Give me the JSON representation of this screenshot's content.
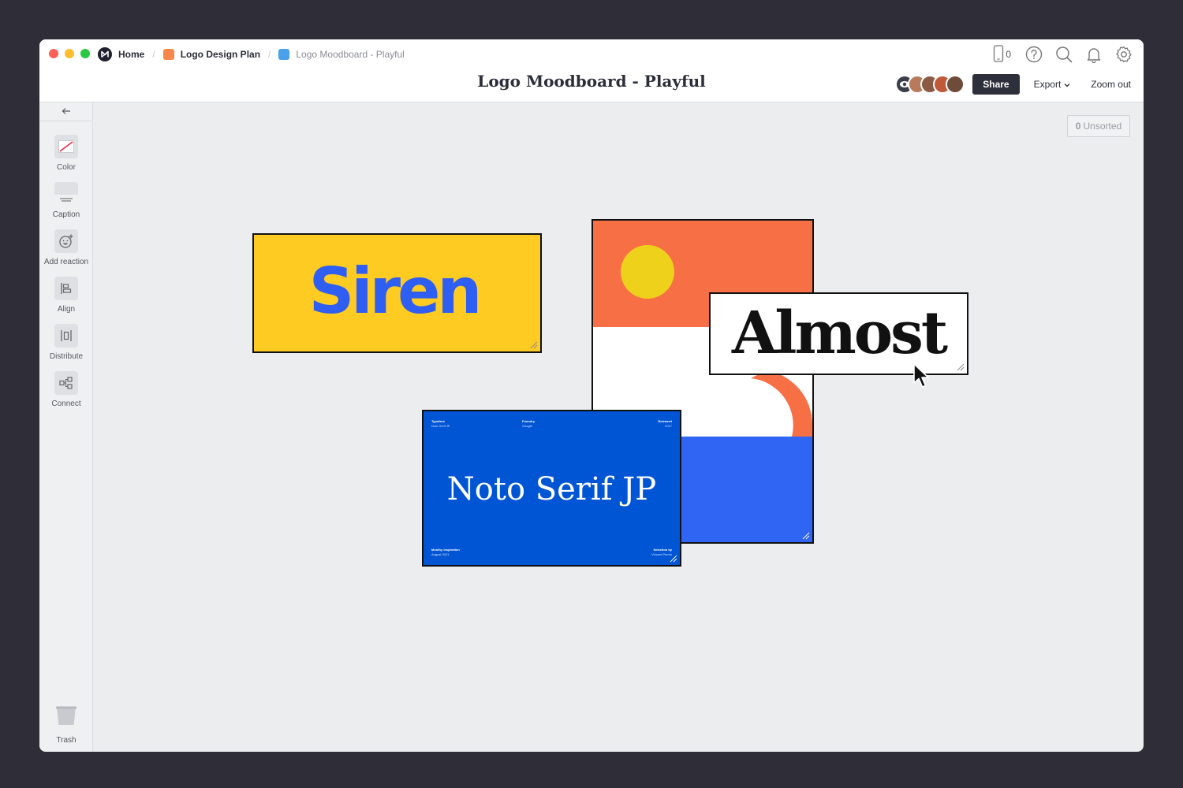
{
  "breadcrumbs": {
    "home": "Home",
    "project": "Logo Design Plan",
    "board": "Logo Moodboard - Playful",
    "project_color": "#f7884a",
    "board_color": "#4aa0ea"
  },
  "document_title": "Logo Moodboard - Playful",
  "toolbar": {
    "device_count": "0",
    "share_label": "Share",
    "export_label": "Export",
    "zoom_label": "Zoom out",
    "icons": [
      "mobile-device-icon",
      "help-icon",
      "search-icon",
      "bell-icon",
      "settings-icon"
    ]
  },
  "collaborators": [
    {
      "icon": "eye-icon",
      "color": "#3b3d47"
    },
    {
      "icon": "avatar",
      "color": "#b77b5c"
    },
    {
      "icon": "avatar",
      "color": "#8a5a44"
    },
    {
      "icon": "avatar",
      "color": "#c0583a"
    },
    {
      "icon": "avatar",
      "color": "#6f4b3a"
    }
  ],
  "sidebar": {
    "collapse_icon": "arrow-left-icon",
    "tools": [
      {
        "label": "Color",
        "icon": "color-icon"
      },
      {
        "label": "Caption",
        "icon": "caption-icon"
      },
      {
        "label": "Add reaction",
        "icon": "reaction-icon"
      },
      {
        "label": "Align",
        "icon": "align-icon"
      },
      {
        "label": "Distribute",
        "icon": "distribute-icon"
      },
      {
        "label": "Connect",
        "icon": "connect-icon"
      }
    ],
    "trash_label": "Trash"
  },
  "unsorted": {
    "count": "0",
    "label": "Unsorted"
  },
  "cards": {
    "siren": {
      "text": "Siren",
      "bg": "#fecb22",
      "fg": "#2f5ef3"
    },
    "almost": {
      "text": "Almost"
    },
    "poster": {
      "colors": [
        "#f76f45",
        "#eed11b",
        "#ffffff",
        "#3065f4"
      ]
    },
    "noto": {
      "title": "Noto Serif JP",
      "meta_top": [
        {
          "h": "Typeface",
          "v": "Noto Serif JP"
        },
        {
          "h": "Foundry",
          "v": "Google"
        },
        {
          "h": "Released",
          "v": "2017"
        }
      ],
      "meta_bottom": [
        {
          "h": "Monthy inspiration",
          "v": "August 2021"
        },
        {
          "h": "Selection by",
          "v": "Vincent Pernin"
        }
      ]
    }
  }
}
